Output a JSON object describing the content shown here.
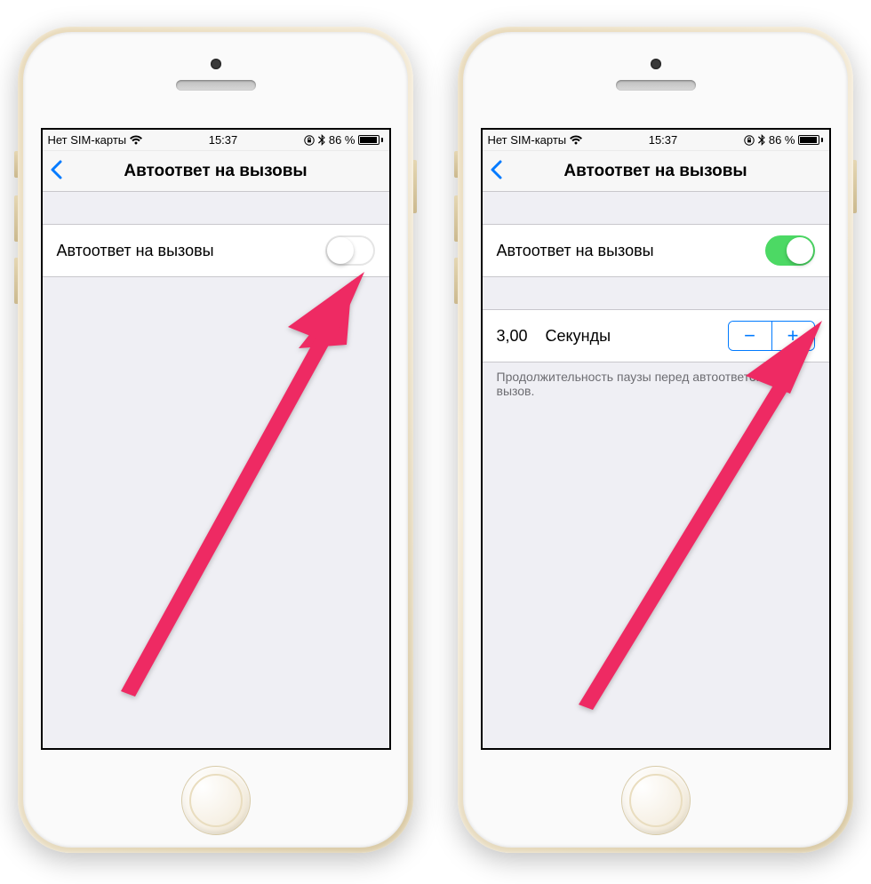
{
  "status": {
    "carrier": "Нет SIM-карты",
    "time": "15:37",
    "battery_pct": "86 %"
  },
  "nav": {
    "title": "Автоответ на вызовы"
  },
  "cells": {
    "auto_answer_label": "Автоответ на вызовы",
    "seconds_value": "3,00",
    "seconds_label": "Секунды"
  },
  "footer": {
    "duration_desc": "Продолжительность паузы перед автоответом на вызов."
  },
  "colors": {
    "ios_blue": "#007aff",
    "ios_green": "#4cd964",
    "arrow": "#ee2a63"
  }
}
